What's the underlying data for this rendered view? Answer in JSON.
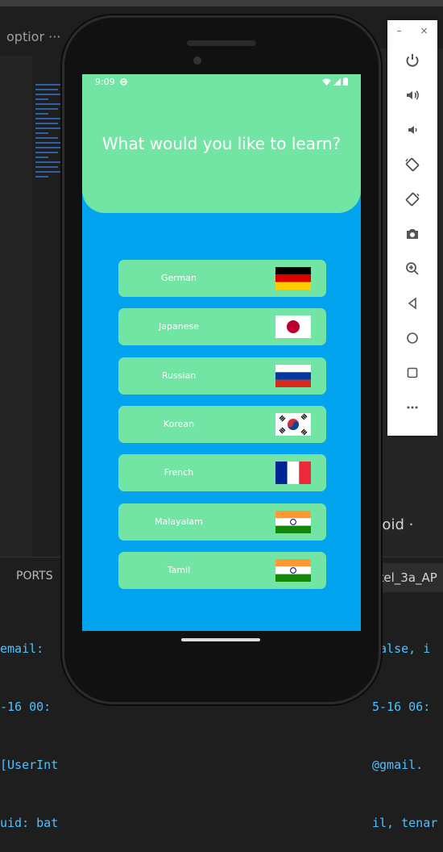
{
  "ide": {
    "tab_text": "optior ···",
    "status_text": "droid ·",
    "ports_label": "PORTS",
    "tab_name": "xel_3a_AP",
    "terminal_left": [
      "email:",
      "-16 00:",
      "[UserInt",
      "uid: bat"
    ],
    "terminal_right": [
      "false, i",
      "5-16 06:",
      "@gmail.",
      "il, tenar"
    ]
  },
  "emulator_panel": {
    "window_buttons": [
      "–",
      "×"
    ],
    "buttons": [
      {
        "icon": "power-icon"
      },
      {
        "icon": "volume-up-icon"
      },
      {
        "icon": "volume-down-icon"
      },
      {
        "icon": "rotate-left-icon"
      },
      {
        "icon": "rotate-right-icon"
      },
      {
        "icon": "camera-icon"
      },
      {
        "icon": "zoom-icon"
      },
      {
        "icon": "back-icon"
      },
      {
        "icon": "home-icon"
      },
      {
        "icon": "overview-icon"
      },
      {
        "icon": "more-icon"
      }
    ]
  },
  "phone": {
    "status_time": "9:09",
    "title": "What would you like to learn?",
    "colors": {
      "background": "#03a4ef",
      "accent": "#72e4a4"
    },
    "languages": [
      {
        "label": "German",
        "flag": "germany-flag-icon"
      },
      {
        "label": "Japanese",
        "flag": "japan-flag-icon"
      },
      {
        "label": "Russian",
        "flag": "russia-flag-icon"
      },
      {
        "label": "Korean",
        "flag": "south-korea-flag-icon"
      },
      {
        "label": "French",
        "flag": "france-flag-icon"
      },
      {
        "label": "Malayalam",
        "flag": "india-flag-icon"
      },
      {
        "label": "Tamil",
        "flag": "india-flag-icon"
      }
    ]
  }
}
